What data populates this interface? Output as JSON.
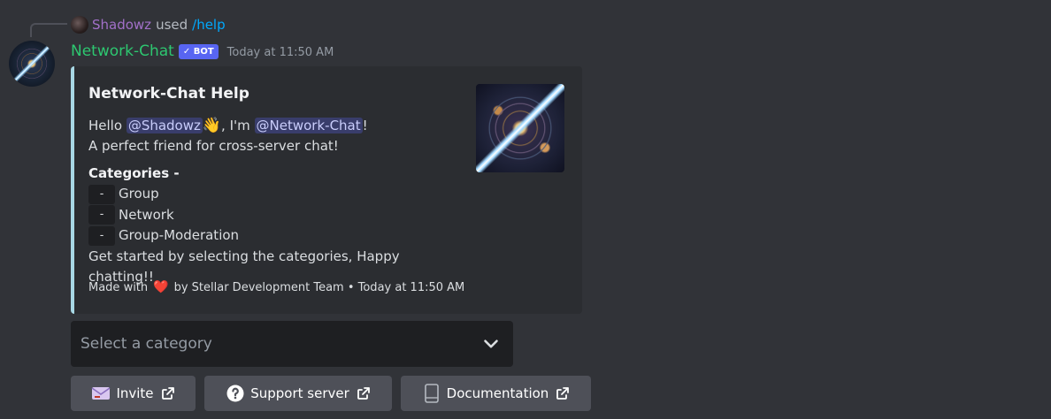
{
  "reply": {
    "user": "Shadowz",
    "used": "used",
    "command": "/help"
  },
  "message": {
    "author": "Network-Chat",
    "bot_tag": "✓ BOT",
    "timestamp": "Today at 11:50 AM"
  },
  "embed": {
    "accent_color": "#a8d8e5",
    "title": "Network-Chat Help",
    "hello": "Hello",
    "mention_user": "@Shadowz",
    "wave_emoji": "👋",
    "im": ", I'm",
    "mention_bot": "@Network-Chat",
    "exclaim": "!",
    "tagline": "A perfect friend for cross-server chat!",
    "categories_heading": "Categories -",
    "categories": [
      {
        "dash": "-",
        "label": "Group"
      },
      {
        "dash": "-",
        "label": "Network"
      },
      {
        "dash": "-",
        "label": "Group-Moderation"
      }
    ],
    "get_started": "Get started by selecting the categories, Happy chatting!!",
    "footer_made_with": "Made with",
    "footer_heart": "❤️",
    "footer_by": "by Stellar Development Team • Today at 11:50 AM"
  },
  "select": {
    "placeholder": "Select a category",
    "icon": "chevron-down-icon"
  },
  "buttons": [
    {
      "label": "Invite",
      "icon": "envelope-icon"
    },
    {
      "label": "Support server",
      "icon": "question-circle-icon"
    },
    {
      "label": "Documentation",
      "icon": "book-icon"
    }
  ],
  "colors": {
    "background": "#313338",
    "embed_bg": "#2b2d31",
    "bot_name": "#2dc770",
    "bot_tag": "#5865f2",
    "button": "#4e5058"
  }
}
